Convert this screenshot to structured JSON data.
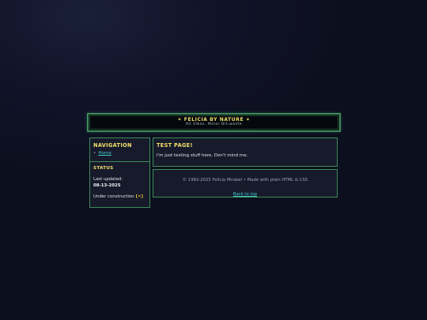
{
  "header": {
    "title": "✶ FELICIA BY NATURE ✶",
    "tagline": "All Vibes. Minor Bit-waste"
  },
  "nav": {
    "heading": "NAVIGATION",
    "items": [
      {
        "label": "Home"
      }
    ]
  },
  "status": {
    "heading": "STATUS",
    "last_updated_label": "Last updated:",
    "last_updated_value": "08-13-2025",
    "construction_text": "Under construction",
    "construction_icon": "[✕]"
  },
  "main": {
    "heading": "TEST PAGE!",
    "text": "I'm just testing stuff here. Don't mind me."
  },
  "footer": {
    "copyright": "© 1982-2025 Felicia Mirabel • Made with plain HTML & CSS",
    "back_to_top": "Back to top"
  },
  "colors": {
    "accent_yellow": "#f1e06a",
    "border_green": "#3c8d5a",
    "link_cyan": "#3fcfd1",
    "panel_bg": "#171a2a"
  }
}
